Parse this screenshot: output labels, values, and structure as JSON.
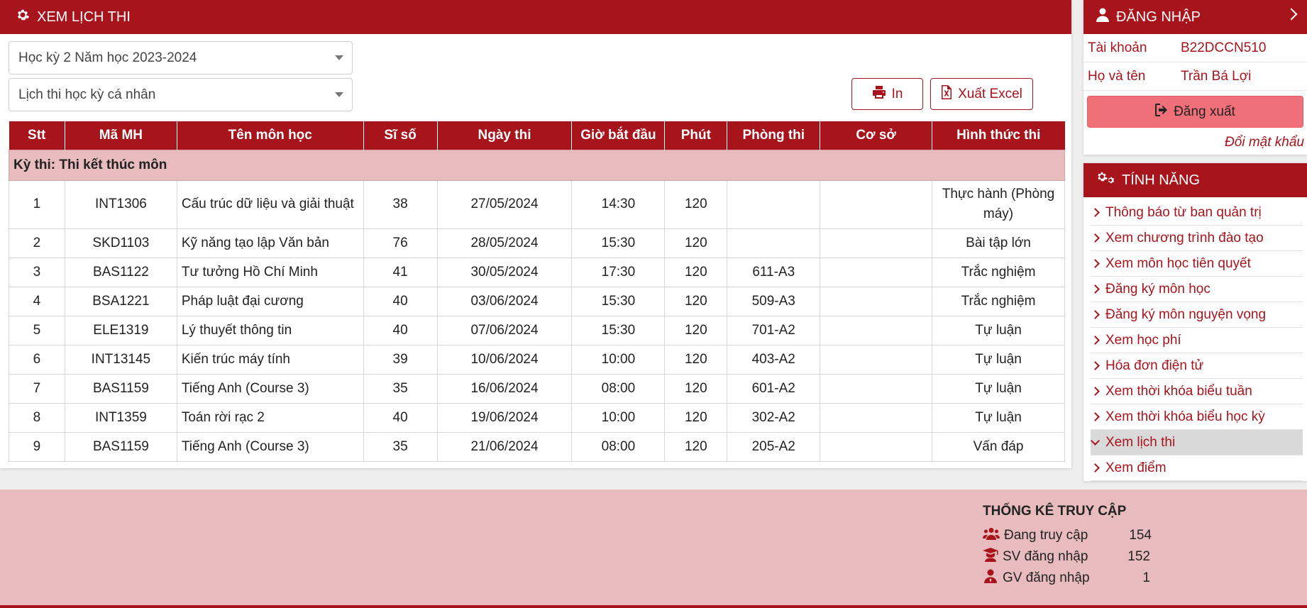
{
  "main": {
    "title": "XEM LỊCH THI",
    "semester_select": "Học kỳ 2 Năm học 2023-2024",
    "type_select": "Lịch thi học kỳ cá nhân",
    "print_label": "In",
    "excel_label": "Xuất Excel"
  },
  "table": {
    "headers": [
      "Stt",
      "Mã MH",
      "Tên môn học",
      "Sĩ số",
      "Ngày thi",
      "Giờ bắt đầu",
      "Phút",
      "Phòng thi",
      "Cơ sở",
      "Hình thức thi"
    ],
    "group_label": "Kỳ thi: Thi kết thúc môn",
    "rows": [
      [
        "1",
        "INT1306",
        "Cấu trúc dữ liệu và giải thuật",
        "38",
        "27/05/2024",
        "14:30",
        "120",
        "",
        "",
        "Thực hành (Phòng máy)"
      ],
      [
        "2",
        "SKD1103",
        "Kỹ năng tạo lập Văn bản",
        "76",
        "28/05/2024",
        "15:30",
        "120",
        "",
        "",
        "Bài tập lớn"
      ],
      [
        "3",
        "BAS1122",
        "Tư tưởng Hồ Chí Minh",
        "41",
        "30/05/2024",
        "17:30",
        "120",
        "611-A3",
        "",
        "Trắc nghiệm"
      ],
      [
        "4",
        "BSA1221",
        "Pháp luật đại cương",
        "40",
        "03/06/2024",
        "15:30",
        "120",
        "509-A3",
        "",
        "Trắc nghiệm"
      ],
      [
        "5",
        "ELE1319",
        "Lý thuyết thông tin",
        "40",
        "07/06/2024",
        "15:30",
        "120",
        "701-A2",
        "",
        "Tự luận"
      ],
      [
        "6",
        "INT13145",
        "Kiến trúc máy tính",
        "39",
        "10/06/2024",
        "10:00",
        "120",
        "403-A2",
        "",
        "Tự luận"
      ],
      [
        "7",
        "BAS1159",
        "Tiếng Anh (Course 3)",
        "35",
        "16/06/2024",
        "08:00",
        "120",
        "601-A2",
        "",
        "Tự luận"
      ],
      [
        "8",
        "INT1359",
        "Toán rời rạc 2",
        "40",
        "19/06/2024",
        "10:00",
        "120",
        "302-A2",
        "",
        "Tự luận"
      ],
      [
        "9",
        "BAS1159",
        "Tiếng Anh (Course 3)",
        "35",
        "21/06/2024",
        "08:00",
        "120",
        "205-A2",
        "",
        "Vấn đáp"
      ]
    ]
  },
  "login": {
    "title": "ĐĂNG NHẬP",
    "account_label": "Tài khoản",
    "account_value": "B22DCCN510",
    "name_label": "Họ và tên",
    "name_value": "Trần Bá Lợi",
    "logout_label": "Đăng xuất",
    "change_password": "Đổi mật khẩu"
  },
  "features": {
    "title": "TÍNH NĂNG",
    "items": [
      "Thông báo từ ban quản trị",
      "Xem chương trình đào tạo",
      "Xem môn học tiên quyết",
      "Đăng ký môn học",
      "Đăng ký môn nguyện vọng",
      "Xem học phí",
      "Hóa đơn điện tử",
      "Xem thời khóa biểu tuần",
      "Xem thời khóa biểu học kỳ",
      "Xem lịch thi",
      "Xem điểm"
    ],
    "active_index": 9
  },
  "stats": {
    "title": "THỐNG KÊ TRUY CẬP",
    "online_label": "Đang truy cập",
    "online_value": "154",
    "students_label": "SV đăng nhập",
    "students_value": "152",
    "teachers_label": "GV đăng nhập",
    "teachers_value": "1"
  },
  "colors": {
    "brand_red": "#a8141c",
    "footer_pink": "#e8bcbe",
    "logout_button": "#f0707a"
  }
}
